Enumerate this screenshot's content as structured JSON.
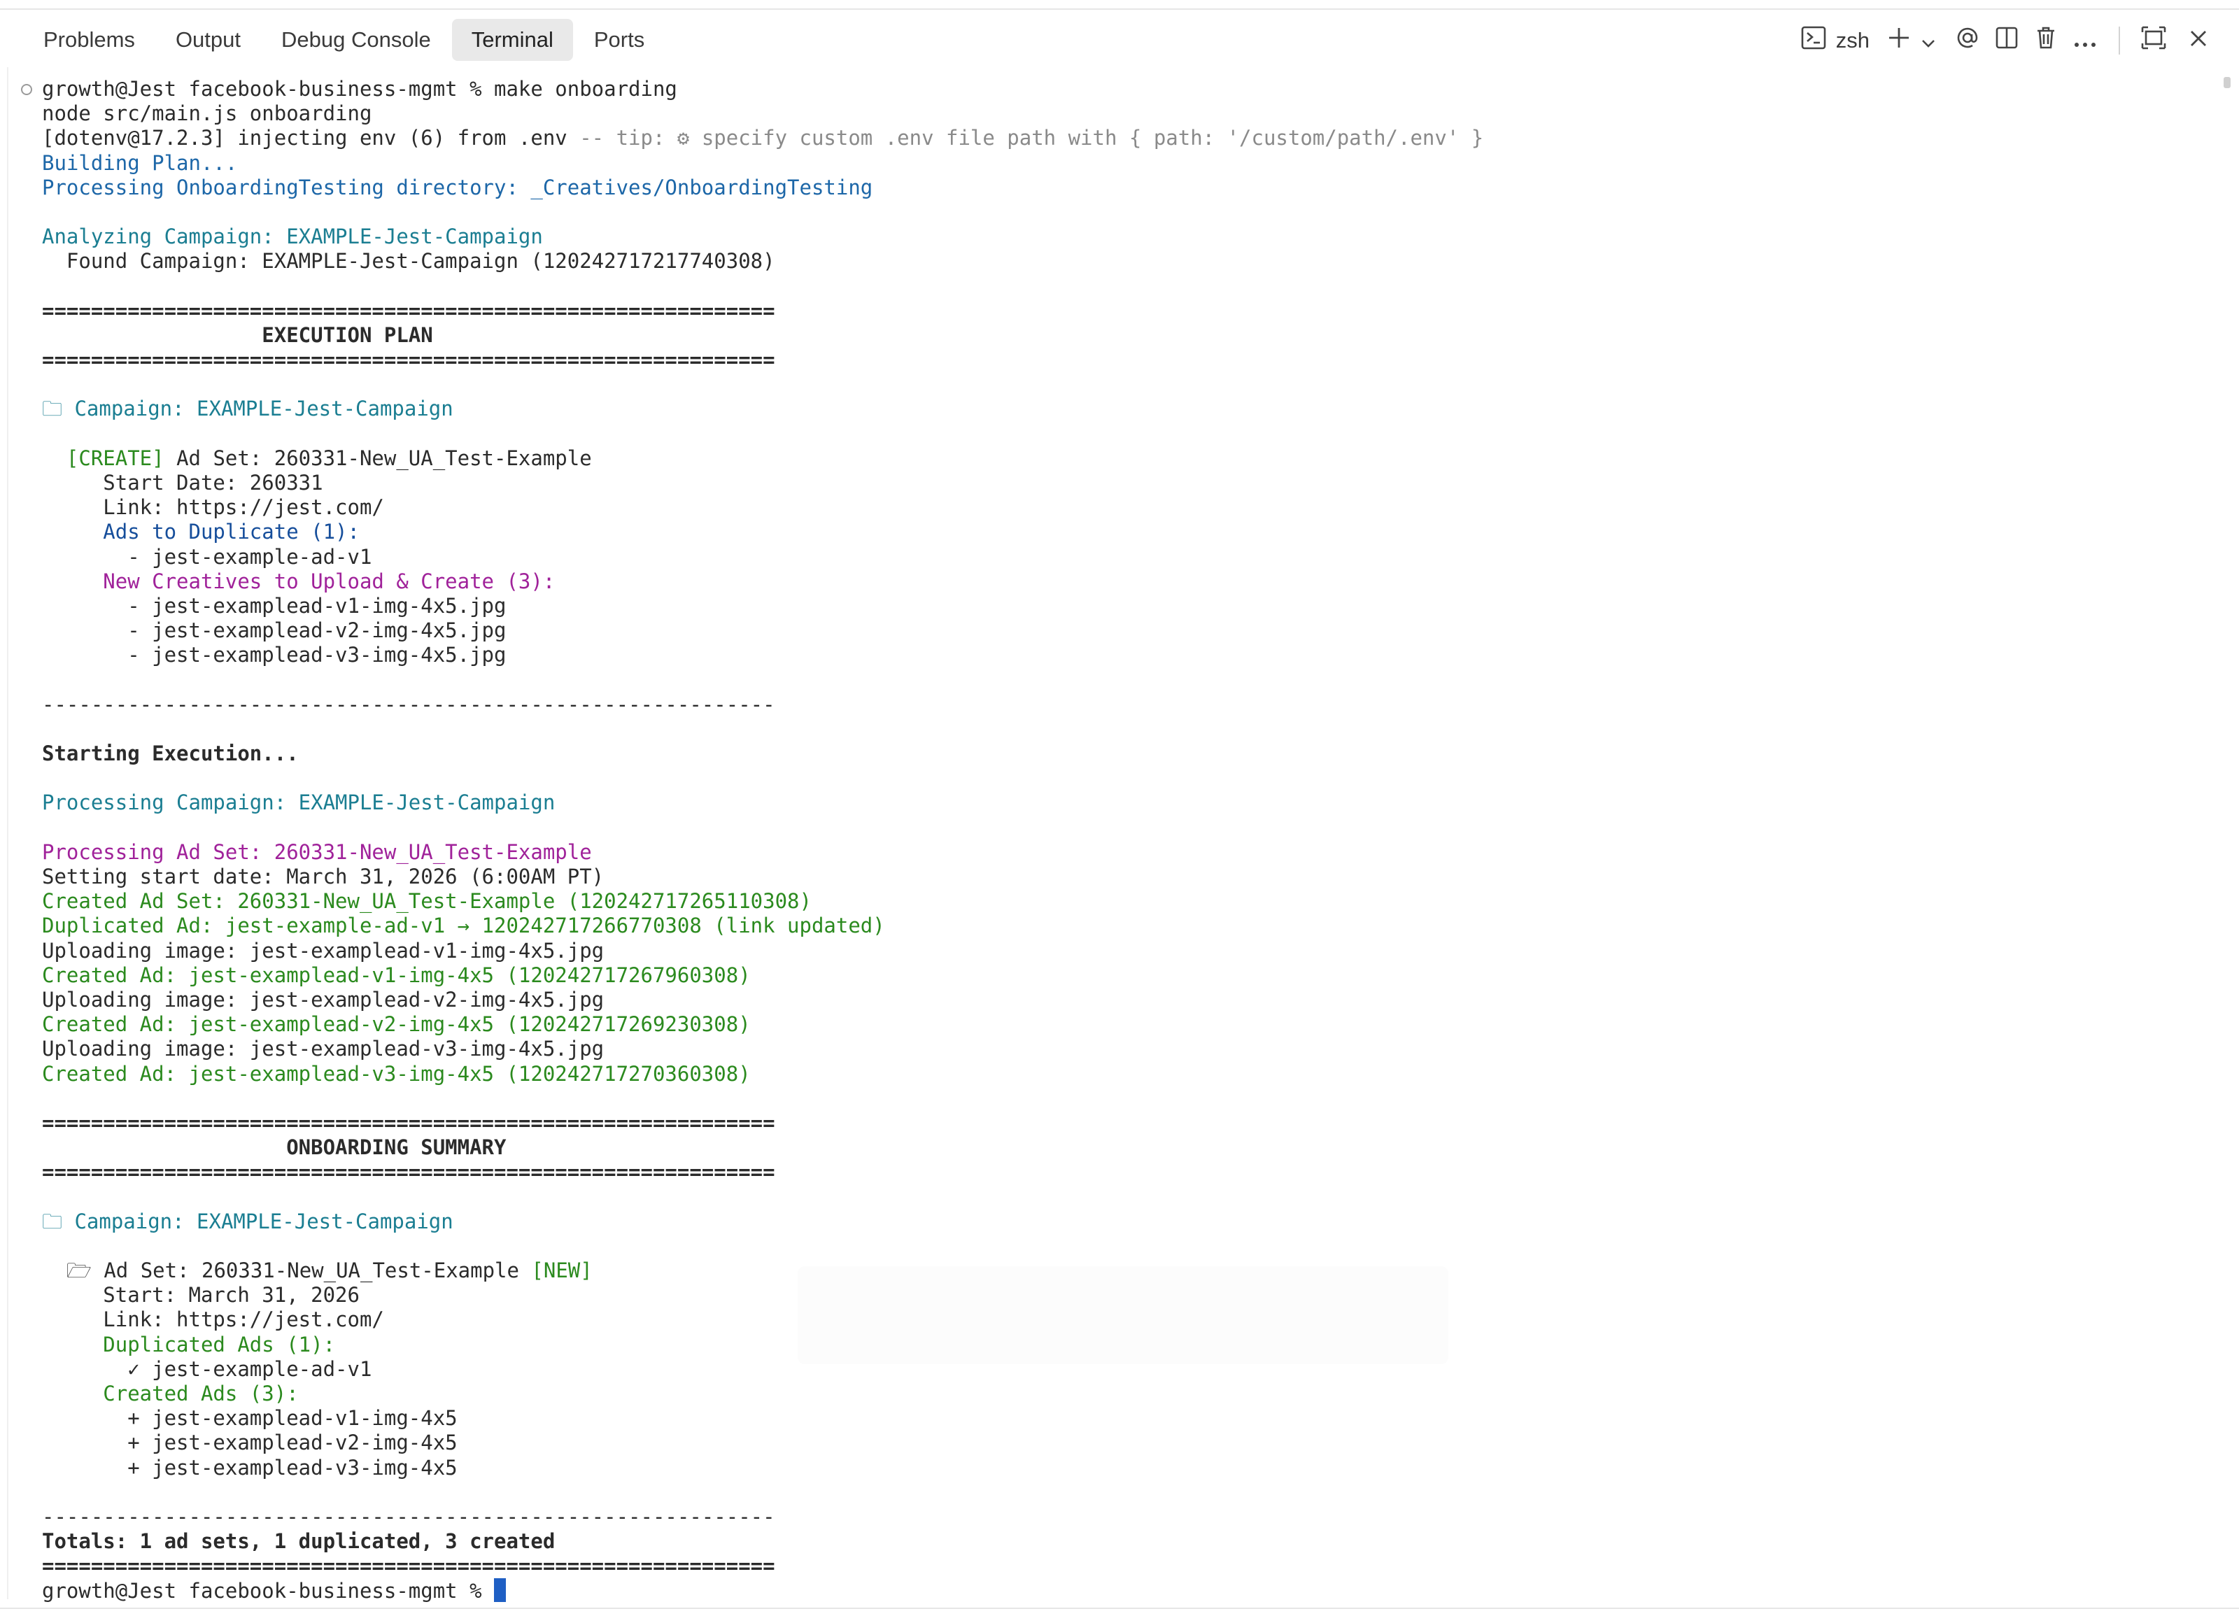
{
  "panel": {
    "tabs": [
      {
        "label": "Problems"
      },
      {
        "label": "Output"
      },
      {
        "label": "Debug Console"
      },
      {
        "label": "Terminal",
        "active": true
      },
      {
        "label": "Ports"
      }
    ],
    "shell_label": "zsh",
    "icons": [
      "terminal-icon",
      "plus-icon",
      "chevron-down-icon",
      "at-icon",
      "split-icon",
      "trash-icon",
      "more-icon",
      "maximize-icon",
      "close-icon"
    ]
  },
  "terminal": {
    "lines": [
      {
        "t": "growth@Jest facebook-business-mgmt % make onboarding",
        "c": ""
      },
      {
        "t": "node src/main.js onboarding",
        "c": ""
      },
      {
        "t": "[dotenv@17.2.3] injecting env (6) from .env ",
        "c": "",
        "tail": "-- tip: ⚙ specify custom .env file path with { path: '/custom/path/.env' }",
        "tail_c": "c-gray"
      },
      {
        "t": "Building Plan...",
        "c": "c-blue"
      },
      {
        "t": "Processing OnboardingTesting directory: _Creatives/OnboardingTesting",
        "c": "c-blue"
      },
      {
        "t": "",
        "c": ""
      },
      {
        "t": "Analyzing Campaign: EXAMPLE-Jest-Campaign",
        "c": "c-teal"
      },
      {
        "t": "  Found Campaign: EXAMPLE-Jest-Campaign (120242717217740308)",
        "c": ""
      },
      {
        "t": "",
        "c": ""
      },
      {
        "t": "============================================================",
        "c": "bold"
      },
      {
        "t": "                  EXECUTION PLAN",
        "c": "bold"
      },
      {
        "t": "============================================================",
        "c": "bold"
      },
      {
        "t": "",
        "c": ""
      },
      {
        "t": "🗀 Campaign: EXAMPLE-Jest-Campaign",
        "c": "c-teal"
      },
      {
        "t": "",
        "c": ""
      },
      {
        "t": "  [CREATE] ",
        "c": "c-green",
        "tail": "Ad Set: 260331-New_UA_Test-Example",
        "tail_c": ""
      },
      {
        "t": "     Start Date: 260331",
        "c": ""
      },
      {
        "t": "     Link: https://jest.com/",
        "c": ""
      },
      {
        "t": "     Ads to Duplicate (1):",
        "c": "c-darkblue"
      },
      {
        "t": "       - jest-example-ad-v1",
        "c": ""
      },
      {
        "t": "     New Creatives to Upload & Create (3):",
        "c": "c-purple"
      },
      {
        "t": "       - jest-examplead-v1-img-4x5.jpg",
        "c": ""
      },
      {
        "t": "       - jest-examplead-v2-img-4x5.jpg",
        "c": ""
      },
      {
        "t": "       - jest-examplead-v3-img-4x5.jpg",
        "c": ""
      },
      {
        "t": "",
        "c": ""
      },
      {
        "t": "------------------------------------------------------------",
        "c": ""
      },
      {
        "t": "",
        "c": ""
      },
      {
        "t": "Starting Execution...",
        "c": "bold"
      },
      {
        "t": "",
        "c": ""
      },
      {
        "t": "Processing Campaign: EXAMPLE-Jest-Campaign",
        "c": "c-teal"
      },
      {
        "t": "",
        "c": ""
      },
      {
        "t": "Processing Ad Set: 260331-New_UA_Test-Example",
        "c": "c-purple"
      },
      {
        "t": "Setting start date: March 31, 2026 (6:00AM PT)",
        "c": ""
      },
      {
        "t": "Created Ad Set: 260331-New_UA_Test-Example (120242717265110308)",
        "c": "c-green"
      },
      {
        "t": "Duplicated Ad: jest-example-ad-v1 → 120242717266770308 (link updated)",
        "c": "c-green"
      },
      {
        "t": "Uploading image: jest-examplead-v1-img-4x5.jpg",
        "c": ""
      },
      {
        "t": "Created Ad: jest-examplead-v1-img-4x5 (120242717267960308)",
        "c": "c-green"
      },
      {
        "t": "Uploading image: jest-examplead-v2-img-4x5.jpg",
        "c": ""
      },
      {
        "t": "Created Ad: jest-examplead-v2-img-4x5 (120242717269230308)",
        "c": "c-green"
      },
      {
        "t": "Uploading image: jest-examplead-v3-img-4x5.jpg",
        "c": ""
      },
      {
        "t": "Created Ad: jest-examplead-v3-img-4x5 (120242717270360308)",
        "c": "c-green"
      },
      {
        "t": "",
        "c": ""
      },
      {
        "t": "============================================================",
        "c": "bold"
      },
      {
        "t": "                    ONBOARDING SUMMARY",
        "c": "bold"
      },
      {
        "t": "============================================================",
        "c": "bold"
      },
      {
        "t": "",
        "c": ""
      },
      {
        "t": "🗀 Campaign: EXAMPLE-Jest-Campaign",
        "c": "c-teal"
      },
      {
        "t": "",
        "c": ""
      },
      {
        "t": "  🗁 Ad Set: 260331-New_UA_Test-Example ",
        "c": "",
        "tail": "[NEW]",
        "tail_c": "c-green"
      },
      {
        "t": "     Start: March 31, 2026",
        "c": ""
      },
      {
        "t": "     Link: https://jest.com/",
        "c": ""
      },
      {
        "t": "     Duplicated Ads (1):",
        "c": "c-green"
      },
      {
        "t": "       ✓ jest-example-ad-v1",
        "c": ""
      },
      {
        "t": "     Created Ads (3):",
        "c": "c-green"
      },
      {
        "t": "       + jest-examplead-v1-img-4x5",
        "c": ""
      },
      {
        "t": "       + jest-examplead-v2-img-4x5",
        "c": ""
      },
      {
        "t": "       + jest-examplead-v3-img-4x5",
        "c": ""
      },
      {
        "t": "",
        "c": ""
      },
      {
        "t": "------------------------------------------------------------",
        "c": ""
      },
      {
        "t": "Totals: 1 ad sets, 1 duplicated, 3 created",
        "c": "bold"
      },
      {
        "t": "============================================================",
        "c": "bold"
      }
    ],
    "prompt": "growth@Jest facebook-business-mgmt % "
  }
}
